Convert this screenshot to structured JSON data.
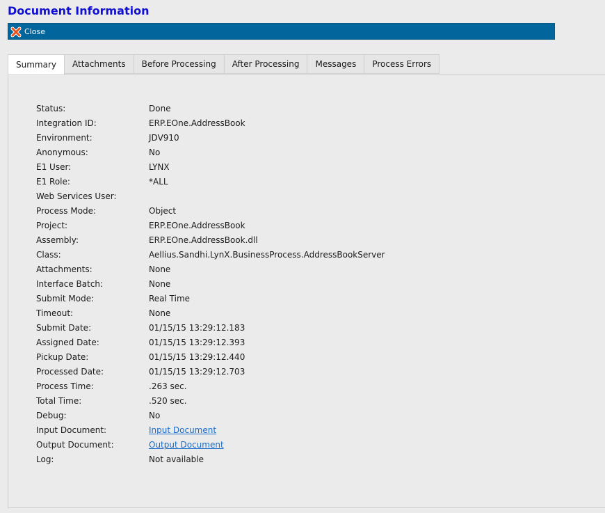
{
  "window": {
    "title": "Document Information"
  },
  "toolbar": {
    "close_label": "Close",
    "close_icon": "close-icon",
    "accent": "#02659c"
  },
  "tabs": [
    {
      "label": "Summary",
      "active": true
    },
    {
      "label": "Attachments",
      "active": false
    },
    {
      "label": "Before Processing",
      "active": false
    },
    {
      "label": "After Processing",
      "active": false
    },
    {
      "label": "Messages",
      "active": false
    },
    {
      "label": "Process Errors",
      "active": false
    }
  ],
  "summary": [
    {
      "label": "Status:",
      "value": "Done"
    },
    {
      "label": "Integration ID:",
      "value": "ERP.EOne.AddressBook"
    },
    {
      "label": "Environment:",
      "value": "JDV910"
    },
    {
      "label": "Anonymous:",
      "value": "No"
    },
    {
      "label": "E1 User:",
      "value": "LYNX"
    },
    {
      "label": "E1 Role:",
      "value": "*ALL"
    },
    {
      "label": "Web Services User:",
      "value": ""
    },
    {
      "label": "Process Mode:",
      "value": "Object"
    },
    {
      "label": "Project:",
      "value": "ERP.EOne.AddressBook"
    },
    {
      "label": "Assembly:",
      "value": "ERP.EOne.AddressBook.dll"
    },
    {
      "label": "Class:",
      "value": "Aellius.Sandhi.LynX.BusinessProcess.AddressBookServer"
    },
    {
      "label": "Attachments:",
      "value": "None"
    },
    {
      "label": "Interface Batch:",
      "value": "None"
    },
    {
      "label": "Submit Mode:",
      "value": "Real Time"
    },
    {
      "label": "Timeout:",
      "value": "None"
    },
    {
      "label": "Submit Date:",
      "value": "01/15/15 13:29:12.183"
    },
    {
      "label": "Assigned Date:",
      "value": "01/15/15 13:29:12.393"
    },
    {
      "label": "Pickup Date:",
      "value": "01/15/15 13:29:12.440"
    },
    {
      "label": "Processed Date:",
      "value": "01/15/15 13:29:12.703"
    },
    {
      "label": "Process Time:",
      "value": ".263 sec."
    },
    {
      "label": "Total Time:",
      "value": ".520 sec."
    },
    {
      "label": "Debug:",
      "value": "No"
    },
    {
      "label": "Input Document:",
      "value": "Input Document",
      "link": true
    },
    {
      "label": "Output Document:",
      "value": "Output Document",
      "link": true
    },
    {
      "label": "Log:",
      "value": "Not available"
    }
  ]
}
